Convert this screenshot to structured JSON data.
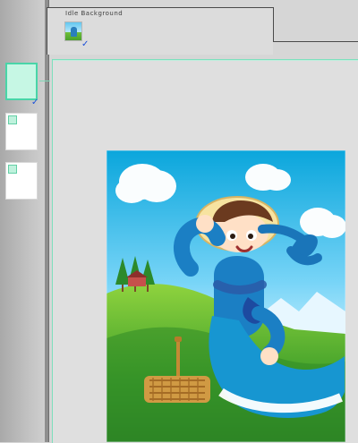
{
  "top_tab": {
    "title": "Idle Background"
  },
  "left_rail": {
    "cards": [
      {
        "name": "slide-1",
        "selected": true,
        "checked": true
      },
      {
        "name": "slide-2",
        "selected": false,
        "checked": false
      },
      {
        "name": "slide-3",
        "selected": false,
        "checked": false
      }
    ]
  },
  "icons": {
    "check": "check-icon",
    "thumbnail": "background-thumbnail-icon"
  },
  "colors": {
    "accent": "#49d5a8",
    "check_blue": "#1b4fd8",
    "canvas_bg": "#dfdfdf"
  }
}
